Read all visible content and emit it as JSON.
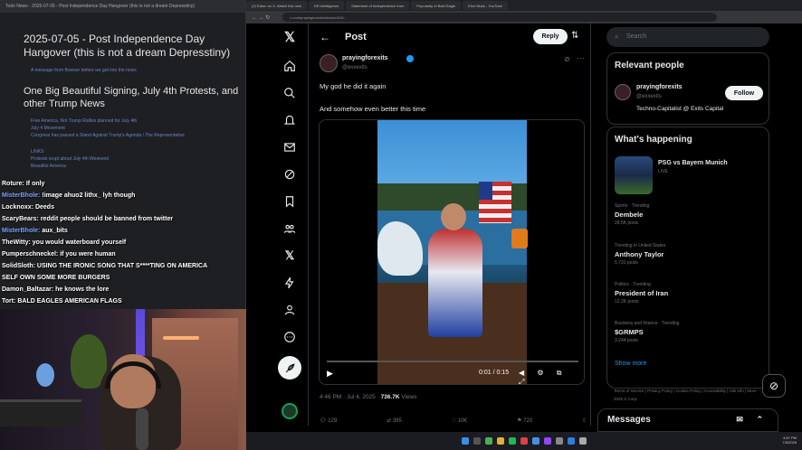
{
  "notes": {
    "titlebar": "Todo News - 2025-07-05 - Post Independence Day Hangover (this is not a dream Depresstiny)",
    "heading": "2025-07-05 - Post Independence Day Hangover (this is not a dream Depresstiny)",
    "first_link": "A message from Bowser before we get into the news",
    "subheading": "One Big Beautiful Signing, July 4th Protests, and other Trump News",
    "links": [
      "Free America, Not Trump Rallies planned for July 4th",
      "July 4 Movement",
      "Congress has passed a Stand Against Trump's Agenda / The Representative",
      "LINKS",
      "Protests erupt about July 4th Weekend",
      "Beautiful America"
    ]
  },
  "chat": [
    {
      "user": "Roture:",
      "msg": "If only",
      "blue": false
    },
    {
      "user": "MisterBhole:",
      "msg": "!image ahuo2 lithx_ lyh though",
      "blue": true
    },
    {
      "user": "Locknoxx:",
      "msg": "Deeds",
      "blue": false
    },
    {
      "user": "ScaryBears:",
      "msg": "reddit people should be banned from twitter",
      "blue": false
    },
    {
      "user": "MisterBhole:",
      "msg": "aux_bits",
      "blue": true
    },
    {
      "user": "TheWitty:",
      "msg": "you would waterboard yourself",
      "blue": false
    },
    {
      "user": "Pumperschneckel:",
      "msg": "if you were human",
      "blue": false
    },
    {
      "user": "SolidSloth:",
      "msg": "USING THE IRONIC SONG THAT S****TING ON AMERICA",
      "blue": false
    },
    {
      "user": "",
      "msg": "SELF OWN SOME MORE BURGERS",
      "blue": false
    },
    {
      "user": "Damon_Baltazar:",
      "msg": "he knows the lore",
      "blue": false
    },
    {
      "user": "Tort:",
      "msg": "BALD EAGLES AMERICAN FLAGS",
      "blue": false
    }
  ],
  "browser": {
    "tabs": [
      "(2) Eaton on X: Watch this new",
      "DR Intelligence",
      "Statement of Independence from",
      "Popularity of Bald Eagle",
      "Elon Musk - YouTube",
      ""
    ],
    "address": "x.com/prayingforexits/status/1941..."
  },
  "post": {
    "header": "Post",
    "reply_label": "Reply",
    "author_name": "prayingforexits",
    "author_handle": "@exxexits",
    "text1": "My god he did it again",
    "text2": "And somehow even better this time",
    "video_time": "0:01 / 0:15",
    "meta_time": "4:46 PM · Jul 4, 2025 · ",
    "views_count": "736.7K",
    "views_label": " Views",
    "actions": {
      "replies": "129",
      "reposts": "395",
      "likes": "10K",
      "bookmarks": "720"
    }
  },
  "right": {
    "search_placeholder": "Search",
    "relevant_title": "Relevant people",
    "rp_name": "prayingforexits",
    "rp_handle": "@exxexits",
    "follow_label": "Follow",
    "rp_bio": "Techno-Capitalist @ Exits Capital",
    "happening_title": "What's happening",
    "event_title": "PSG vs Bayern Munich",
    "event_sub": "LIVE",
    "trends": [
      {
        "category": "Sports · Trending",
        "name": "Dembele",
        "posts": "28.5K posts"
      },
      {
        "category": "Trending in United States",
        "name": "Anthony Taylor",
        "posts": "5,731 posts"
      },
      {
        "category": "Politics · Trending",
        "name": "President of Iran",
        "posts": "12.2K posts"
      },
      {
        "category": "Business and finance · Trending",
        "name": "$GRMPS",
        "posts": "3,244 posts"
      }
    ],
    "show_more": "Show more",
    "footer": "Terms of Service | Privacy Policy | Cookie Policy | Accessibility | Ads info | More ··· © 2025 X Corp.",
    "messages_label": "Messages"
  },
  "taskbar": {
    "time": "4:57 PM",
    "date": "7/5/2025"
  },
  "colors": {
    "accent": "#1d9bf0",
    "background": "#000000",
    "notes_bg": "#1e1f22",
    "link": "#6d83c7"
  }
}
